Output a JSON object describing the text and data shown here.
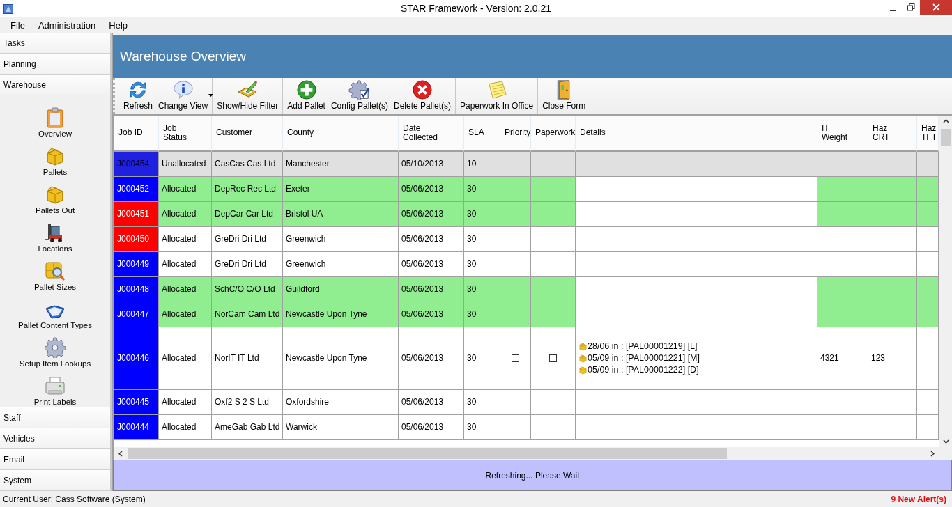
{
  "window": {
    "title": "STAR Framework - Version: 2.0.21"
  },
  "menu": [
    "File",
    "Administration",
    "Help"
  ],
  "sidebar": {
    "sections": [
      {
        "label": "Tasks"
      },
      {
        "label": "Planning"
      },
      {
        "label": "Warehouse",
        "items": [
          "Overview",
          "Pallets",
          "Pallets Out",
          "Locations",
          "Pallet Sizes",
          "Pallet Content Types",
          "Setup Item Lookups",
          "Print Labels"
        ]
      },
      {
        "label": "Staff"
      },
      {
        "label": "Vehicles"
      },
      {
        "label": "Email"
      },
      {
        "label": "System"
      }
    ]
  },
  "form": {
    "title": "Warehouse Overview"
  },
  "toolbar": {
    "groups": [
      [
        {
          "label": "Refresh",
          "dropdown": false
        },
        {
          "label": "Change View",
          "dropdown": true
        }
      ],
      [
        {
          "label": "Show/Hide Filter",
          "dropdown": false
        }
      ],
      [
        {
          "label": "Add Pallet",
          "dropdown": false
        },
        {
          "label": "Config Pallet(s)",
          "dropdown": false
        },
        {
          "label": "Delete Pallet(s)",
          "dropdown": false
        }
      ],
      [
        {
          "label": "Paperwork In Office",
          "dropdown": false
        }
      ],
      [
        {
          "label": "Close Form",
          "dropdown": false
        }
      ]
    ]
  },
  "table": {
    "columns": [
      "Job ID",
      "Job\nStatus",
      "Customer",
      "County",
      "Date\nCollected",
      "SLA",
      "Priority",
      "Paperwork",
      "Details",
      "IT\nWeight",
      "Haz\nCRT",
      "Haz\nTFT"
    ],
    "rows": [
      {
        "job_id": "J000454",
        "job_status": "Unallocated",
        "customer": "CasCas Cas Ltd",
        "county": "Manchester",
        "date_collected": "05/10/2013",
        "sla": "10",
        "kind": "unallocated",
        "color": "#2020e0",
        "selected": true
      },
      {
        "job_id": "J000452",
        "job_status": "Allocated",
        "customer": "DepRec Rec Ltd",
        "county": "Exeter",
        "date_collected": "05/06/2013",
        "sla": "30",
        "kind": "flagged",
        "color": "#0000ff",
        "selected": false
      },
      {
        "job_id": "J000451",
        "job_status": "Allocated",
        "customer": "DepCar Car Ltd",
        "county": "Bristol UA",
        "date_collected": "05/06/2013",
        "sla": "30",
        "kind": "flagged",
        "color": "#ff0000",
        "selected": false
      },
      {
        "job_id": "J000450",
        "job_status": "Allocated",
        "customer": "GreDri Dri Ltd",
        "county": "Greenwich",
        "date_collected": "05/06/2013",
        "sla": "30",
        "kind": "normal",
        "color": "#ff0000",
        "selected": false
      },
      {
        "job_id": "J000449",
        "job_status": "Allocated",
        "customer": "GreDri Dri Ltd",
        "county": "Greenwich",
        "date_collected": "05/06/2013",
        "sla": "30",
        "kind": "normal",
        "color": "#0000ff",
        "selected": false
      },
      {
        "job_id": "J000448",
        "job_status": "Allocated",
        "customer": "SchC/O C/O Ltd",
        "county": "Guildford",
        "date_collected": "05/06/2013",
        "sla": "30",
        "kind": "flagged",
        "color": "#0000ff",
        "selected": false
      },
      {
        "job_id": "J000447",
        "job_status": "Allocated",
        "customer": "NorCam Cam Ltd",
        "county": "Newcastle Upon Tyne",
        "date_collected": "05/06/2013",
        "sla": "30",
        "kind": "flagged",
        "color": "#0000ff",
        "selected": false
      },
      {
        "job_id": "J000446",
        "job_status": "Allocated",
        "customer": "NorIT IT Ltd",
        "county": "Newcastle Upon Tyne",
        "date_collected": "05/06/2013",
        "sla": "30",
        "kind": "normal",
        "color": "#0000ff",
        "selected": false,
        "priority": {
          "checked": false
        },
        "paperwork": {
          "checked": false
        },
        "details": [
          "28/06 in : [PAL00001219] [L]",
          "05/09 in : [PAL00001221] [M]",
          "05/09 in : [PAL00001222] [D]"
        ],
        "it_weight": "4321",
        "haz_crt": "123"
      },
      {
        "job_id": "J000445",
        "job_status": "Allocated",
        "customer": "Oxf2 S 2 S Ltd",
        "county": "Oxfordshire",
        "date_collected": "05/06/2013",
        "sla": "30",
        "kind": "normal",
        "color": "#0000ff",
        "selected": false
      },
      {
        "job_id": "J000444",
        "job_status": "Allocated",
        "customer": "AmeGab Gab Ltd",
        "county": "Warwick",
        "date_collected": "05/06/2013",
        "sla": "30",
        "kind": "normal",
        "color": "#0000ff",
        "selected": false
      }
    ]
  },
  "progress": {
    "message": "Refreshing... Please Wait"
  },
  "status_bar": {
    "user": "Current User: Cass Software (System)",
    "alerts": "9 New Alert(s)"
  }
}
